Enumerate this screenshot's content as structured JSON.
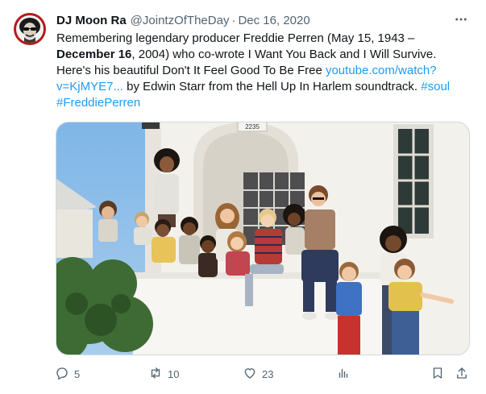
{
  "tweet": {
    "author_name": "DJ Moon Ra",
    "handle": "@JointzOfTheDay",
    "separator": "·",
    "date": "Dec 16, 2020",
    "text": {
      "l1": "Remembering legendary producer Freddie Perren (May 15, 1943 –",
      "l2_bold": "December 16",
      "l2_rest": ", 2004) who co-wrote I Want You Back and I Will Survive.",
      "l3a": "Here's his beautiful Don't It Feel Good To Be Free ",
      "l3_link": "youtube.com/watch?",
      "l4_link": "v=KjMYE7...",
      "l4_rest": " by Edwin Starr from the Hell Up In Harlem soundtrack. ",
      "hashtag1": "#soul",
      "hashtag2": "#FreddiePerren"
    },
    "photo": {
      "house_number": "2235"
    },
    "actions": {
      "replies": "5",
      "reposts": "10",
      "likes": "23"
    },
    "colors": {
      "link": "#1d9bf0",
      "secondary_text": "#536471",
      "avatar_ring": "#b31b1b"
    },
    "icons": [
      "more-icon",
      "reply-icon",
      "repost-icon",
      "like-icon",
      "views-icon",
      "bookmark-icon",
      "share-icon"
    ]
  }
}
